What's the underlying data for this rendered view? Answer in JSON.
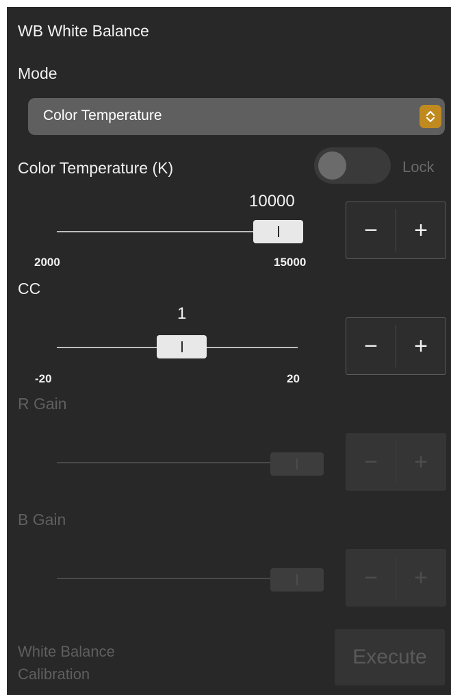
{
  "panel": {
    "title": "WB White Balance"
  },
  "mode": {
    "label": "Mode",
    "selected": "Color Temperature"
  },
  "color_temperature": {
    "label": "Color Temperature (K)",
    "lock_label": "Lock",
    "lock_enabled": false,
    "value": "10000",
    "min": "2000",
    "max": "15000",
    "minus": "−",
    "plus": "+"
  },
  "cc": {
    "label": "CC",
    "value": "1",
    "min": "-20",
    "max": "20",
    "minus": "−",
    "plus": "+"
  },
  "r_gain": {
    "label": "R Gain",
    "disabled": true,
    "minus": "−",
    "plus": "+"
  },
  "b_gain": {
    "label": "B Gain",
    "disabled": true,
    "minus": "−",
    "plus": "+"
  },
  "calibration": {
    "label_line1": "White Balance",
    "label_line2": "Calibration",
    "button": "Execute",
    "disabled": true
  },
  "colors": {
    "panel_bg": "#282828",
    "accent": "#c08a1f",
    "disabled_text": "#5f5f5f"
  }
}
